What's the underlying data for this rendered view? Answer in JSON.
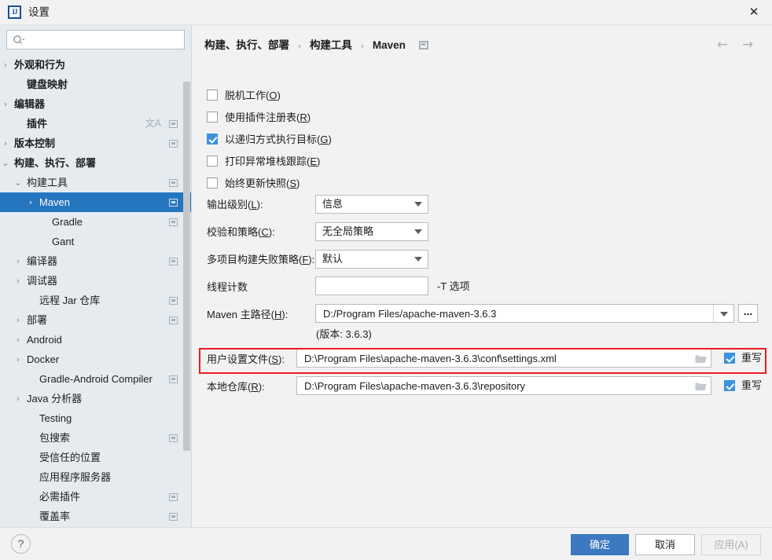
{
  "window": {
    "title": "设置",
    "logo_text": "IJ",
    "close_label": "✕"
  },
  "sidebar": {
    "search": {
      "value": "",
      "placeholder": ""
    },
    "items": [
      {
        "label": "外观和行为",
        "indent": 12,
        "arrow": "›",
        "bold": true,
        "scope": false,
        "translate": false,
        "selected": false
      },
      {
        "label": "键盘映射",
        "indent": 28,
        "arrow": "",
        "bold": true,
        "scope": false,
        "translate": false,
        "selected": false
      },
      {
        "label": "编辑器",
        "indent": 12,
        "arrow": "›",
        "bold": true,
        "scope": false,
        "translate": false,
        "selected": false
      },
      {
        "label": "插件",
        "indent": 28,
        "arrow": "",
        "bold": true,
        "scope": true,
        "translate": true,
        "selected": false
      },
      {
        "label": "版本控制",
        "indent": 12,
        "arrow": "›",
        "bold": true,
        "scope": true,
        "translate": false,
        "selected": false
      },
      {
        "label": "构建、执行、部署",
        "indent": 12,
        "arrow": "⌄",
        "bold": true,
        "scope": false,
        "translate": false,
        "selected": false
      },
      {
        "label": "构建工具",
        "indent": 28,
        "arrow": "⌄",
        "bold": false,
        "scope": true,
        "translate": false,
        "selected": false
      },
      {
        "label": "Maven",
        "indent": 44,
        "arrow": "›",
        "bold": false,
        "scope": true,
        "translate": false,
        "selected": true
      },
      {
        "label": "Gradle",
        "indent": 60,
        "arrow": "",
        "bold": false,
        "scope": true,
        "translate": false,
        "selected": false
      },
      {
        "label": "Gant",
        "indent": 60,
        "arrow": "",
        "bold": false,
        "scope": false,
        "translate": false,
        "selected": false
      },
      {
        "label": "编译器",
        "indent": 28,
        "arrow": "›",
        "bold": false,
        "scope": true,
        "translate": false,
        "selected": false
      },
      {
        "label": "调试器",
        "indent": 28,
        "arrow": "›",
        "bold": false,
        "scope": false,
        "translate": false,
        "selected": false
      },
      {
        "label": "远程 Jar 仓库",
        "indent": 44,
        "arrow": "",
        "bold": false,
        "scope": true,
        "translate": false,
        "selected": false
      },
      {
        "label": "部署",
        "indent": 28,
        "arrow": "›",
        "bold": false,
        "scope": true,
        "translate": false,
        "selected": false
      },
      {
        "label": "Android",
        "indent": 28,
        "arrow": "›",
        "bold": false,
        "scope": false,
        "translate": false,
        "selected": false
      },
      {
        "label": "Docker",
        "indent": 28,
        "arrow": "›",
        "bold": false,
        "scope": false,
        "translate": false,
        "selected": false
      },
      {
        "label": "Gradle-Android Compiler",
        "indent": 44,
        "arrow": "",
        "bold": false,
        "scope": true,
        "translate": false,
        "selected": false
      },
      {
        "label": "Java 分析器",
        "indent": 28,
        "arrow": "›",
        "bold": false,
        "scope": false,
        "translate": false,
        "selected": false
      },
      {
        "label": "Testing",
        "indent": 44,
        "arrow": "",
        "bold": false,
        "scope": false,
        "translate": false,
        "selected": false
      },
      {
        "label": "包搜索",
        "indent": 44,
        "arrow": "",
        "bold": false,
        "scope": true,
        "translate": false,
        "selected": false
      },
      {
        "label": "受信任的位置",
        "indent": 44,
        "arrow": "",
        "bold": false,
        "scope": false,
        "translate": false,
        "selected": false
      },
      {
        "label": "应用程序服务器",
        "indent": 44,
        "arrow": "",
        "bold": false,
        "scope": false,
        "translate": false,
        "selected": false
      },
      {
        "label": "必需插件",
        "indent": 44,
        "arrow": "",
        "bold": false,
        "scope": true,
        "translate": false,
        "selected": false
      },
      {
        "label": "覆盖率",
        "indent": 44,
        "arrow": "",
        "bold": false,
        "scope": true,
        "translate": false,
        "selected": false
      }
    ]
  },
  "main": {
    "breadcrumb": {
      "part1": "构建、执行、部署",
      "sep1": "›",
      "part2": "构建工具",
      "sep2": "›",
      "part3": "Maven"
    },
    "nav": {
      "back": "←",
      "forward": "→"
    },
    "checkboxes": [
      {
        "label": "脱机工作(",
        "mnemonic": "O",
        "tail": ")",
        "checked": false
      },
      {
        "label": "使用插件注册表(",
        "mnemonic": "R",
        "tail": ")",
        "checked": false
      },
      {
        "label": "以递归方式执行目标(",
        "mnemonic": "G",
        "tail": ")",
        "checked": true
      },
      {
        "label": "打印异常堆栈跟踪(",
        "mnemonic": "E",
        "tail": ")",
        "checked": false
      },
      {
        "label": "始终更新快照(",
        "mnemonic": "S",
        "tail": ")",
        "checked": false
      }
    ],
    "output_level": {
      "label": "输出级别(",
      "mnemonic": "L",
      "tail": "):",
      "value": "信息"
    },
    "checksum_policy": {
      "label": "校验和策略(",
      "mnemonic": "C",
      "tail": "):",
      "value": "无全局策略"
    },
    "multiproject_fail_policy": {
      "label": "多项目构建失败策略(",
      "mnemonic": "F",
      "tail": "):",
      "value": "默认"
    },
    "thread_count": {
      "label": "线程计数",
      "value": "",
      "hint": "-T 选项"
    },
    "maven_home": {
      "label": "Maven 主路径(",
      "mnemonic": "H",
      "tail": "):",
      "value": "D:/Program Files/apache-maven-3.6.3",
      "version_note": "(版本: 3.6.3)",
      "browse_label": "..."
    },
    "user_settings_file": {
      "label": "用户设置文件(",
      "mnemonic": "S",
      "tail": "):",
      "value": "D:\\Program Files\\apache-maven-3.6.3\\conf\\settings.xml",
      "override_label": "重写",
      "override_checked": true
    },
    "local_repository": {
      "label": "本地仓库(",
      "mnemonic": "R",
      "tail": "):",
      "value": "D:\\Program Files\\apache-maven-3.6.3\\repository",
      "override_label": "重写",
      "override_checked": true
    }
  },
  "footer": {
    "help_label": "?",
    "ok_label": "确定",
    "cancel_label": "取消",
    "apply_label": "应用(A)"
  },
  "colors": {
    "accent_blue": "#3c79c0",
    "selection_blue": "#2675bf",
    "checkbox_blue": "#3c93dd",
    "annotation_red": "#ee1c22",
    "sidebar_bg": "#e6ebf0",
    "panel_bg": "#f2f2f2"
  }
}
